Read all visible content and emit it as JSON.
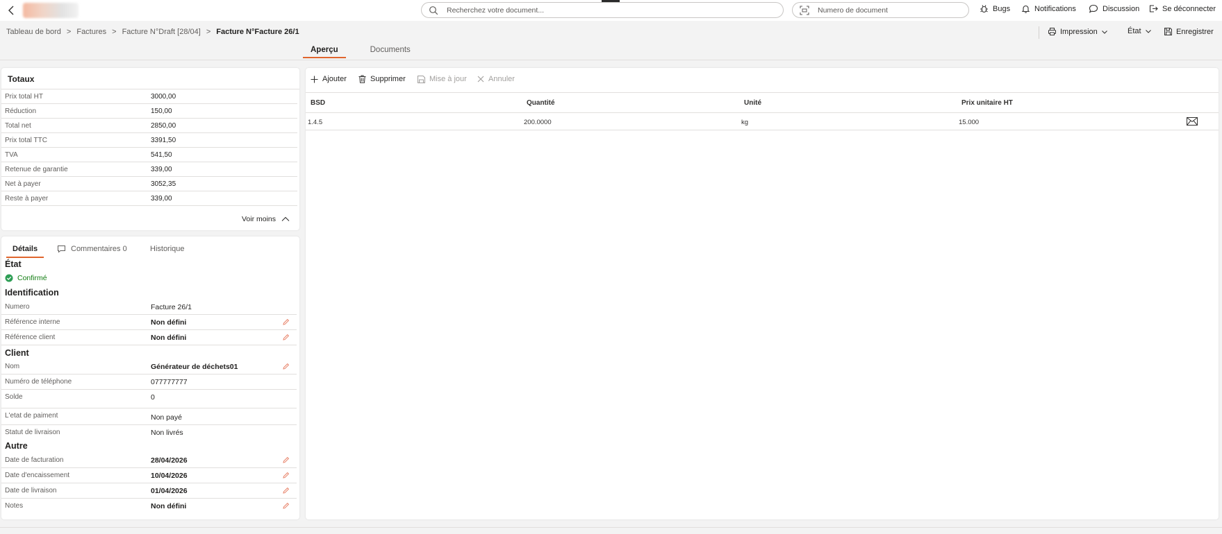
{
  "search": {
    "placeholder": "Recherchez votre document...",
    "number_placeholder": "Numero de document"
  },
  "top_actions": {
    "bugs": "Bugs",
    "notifications": "Notifications",
    "discussion": "Discussion",
    "logout": "Se déconnecter"
  },
  "breadcrumb": {
    "items": [
      "Tableau de bord",
      "Factures",
      "Facture N°Draft [28/04]"
    ],
    "current": "Facture N°Facture 26/1",
    "separator": ">"
  },
  "toolbar": {
    "print": "Impression",
    "state": "État",
    "save": "Enregistrer"
  },
  "main_tabs": [
    {
      "label": "Aperçu",
      "active": true
    },
    {
      "label": "Documents",
      "active": false
    }
  ],
  "totaux": {
    "title": "Totaux",
    "rows": [
      {
        "label": "Prix total HT",
        "value": "3000,00"
      },
      {
        "label": "Réduction",
        "value": "150,00"
      },
      {
        "label": "Total net",
        "value": "2850,00"
      },
      {
        "label": "Prix total TTC",
        "value": "3391,50"
      },
      {
        "label": "TVA",
        "value": "541,50"
      },
      {
        "label": "Retenue de garantie",
        "value": "339,00"
      },
      {
        "label": "Net à payer",
        "value": "3052,35"
      },
      {
        "label": "Reste à payer",
        "value": "339,00"
      }
    ],
    "toggle": "Voir moins"
  },
  "details": {
    "tabs": [
      {
        "label": "Détails"
      },
      {
        "label": "Commentaires 0"
      },
      {
        "label": "Historique"
      }
    ],
    "etat": {
      "title": "État",
      "status": "Confirmé"
    },
    "identification": {
      "title": "Identification",
      "rows": [
        {
          "label": "Numero",
          "value": "Facture 26/1"
        },
        {
          "label": "Référence interne",
          "value": "Non défini"
        },
        {
          "label": "Référence client",
          "value": "Non défini"
        }
      ]
    },
    "client": {
      "title": "Client",
      "rows": [
        {
          "label": "Nom",
          "value": "Générateur de déchets01"
        },
        {
          "label": "Numéro de téléphone",
          "value": "077777777"
        },
        {
          "label": "Solde",
          "value": "0"
        },
        {
          "label": "L'etat de paiment",
          "value": "Non payé"
        },
        {
          "label": "Statut de livraison",
          "value": "Non livrés"
        }
      ]
    },
    "autre": {
      "title": "Autre",
      "rows": [
        {
          "label": "Date de facturation",
          "value": "28/04/2026"
        },
        {
          "label": "Date d'encaissement",
          "value": "10/04/2026"
        },
        {
          "label": "Date de livraison",
          "value": "01/04/2026"
        },
        {
          "label": "Notes",
          "value": "Non défini"
        }
      ]
    }
  },
  "grid": {
    "actions": {
      "add": "Ajouter",
      "delete": "Supprimer",
      "update": "Mise à jour",
      "cancel": "Annuler"
    },
    "columns": [
      "BSD",
      "Quantité",
      "Unité",
      "Prix unitaire HT"
    ],
    "rows": [
      {
        "bsd": "1.4.5",
        "quantite": "200.0000",
        "unite": "kg",
        "prix": "15.000"
      }
    ]
  },
  "colors": {
    "accent": "#e0652d",
    "success": "#107c10",
    "edit_icon": "#e8836a"
  }
}
